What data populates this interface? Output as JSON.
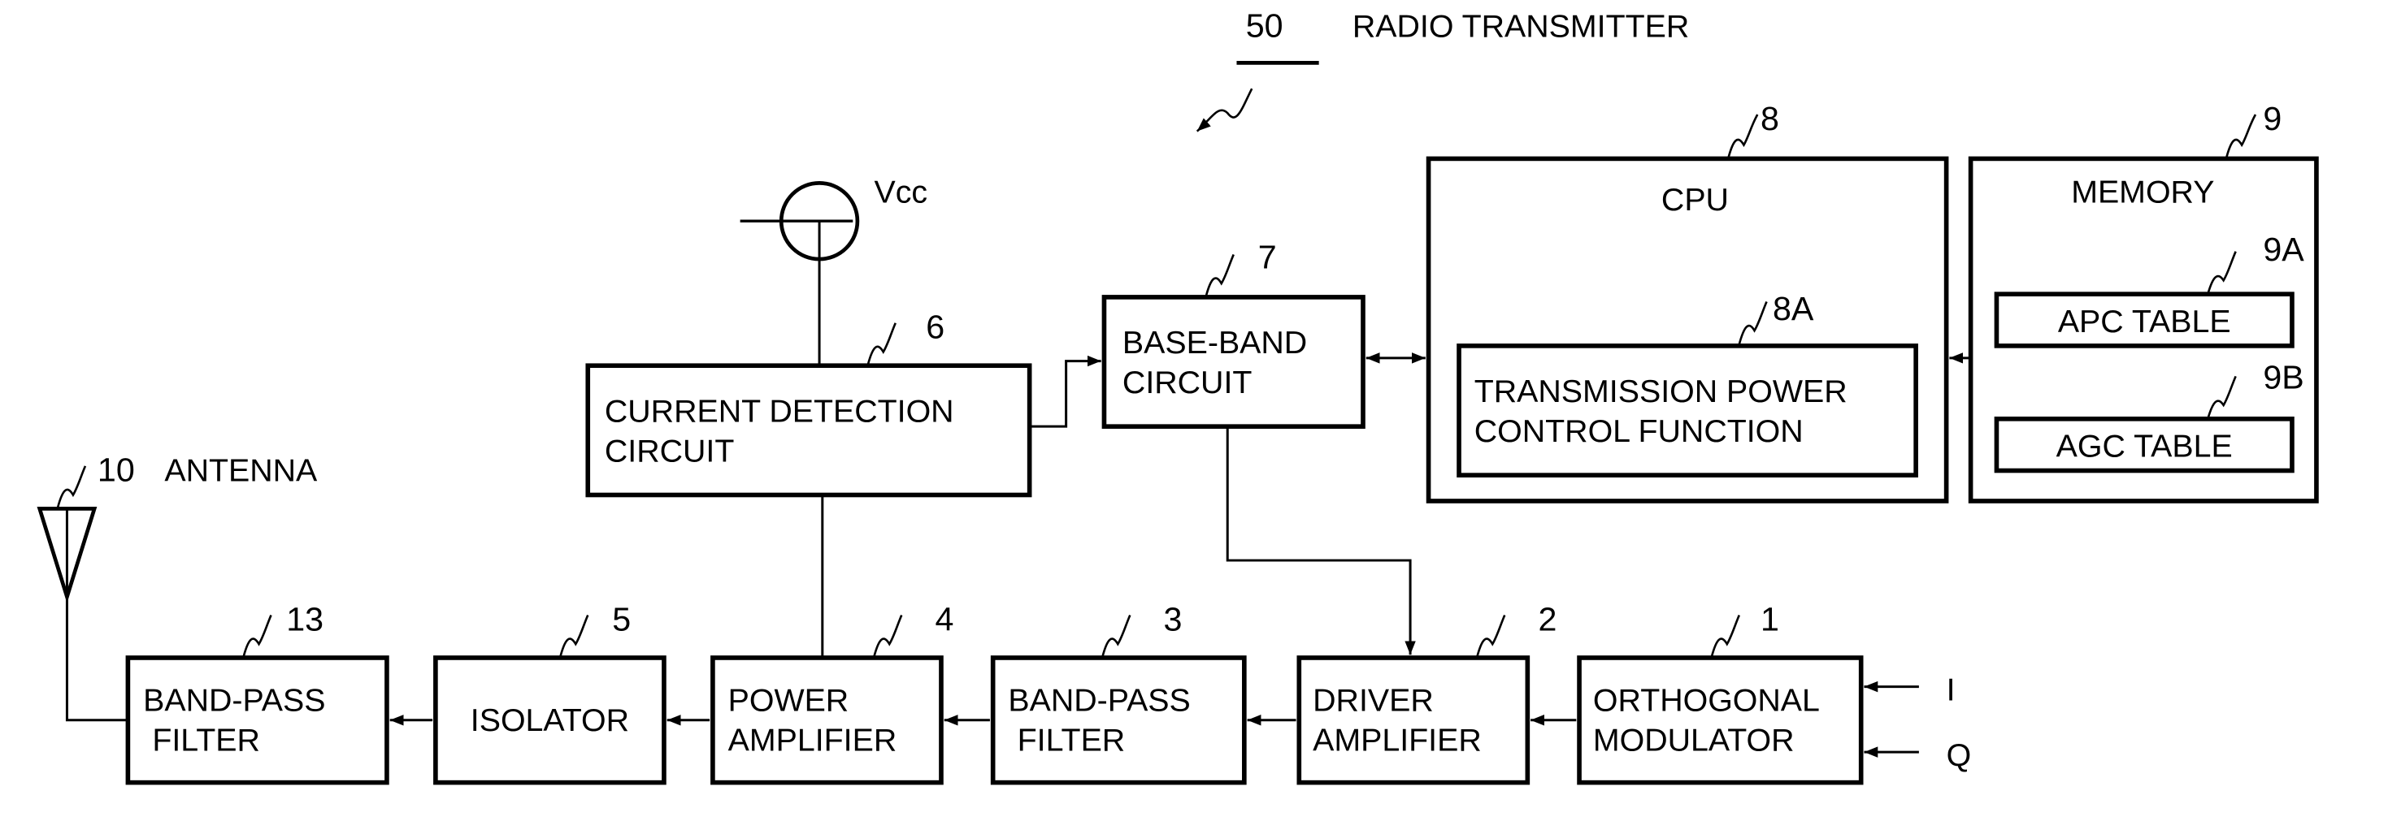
{
  "title": {
    "ref": "50",
    "label": "RADIO TRANSMITTER"
  },
  "supply": {
    "label": "Vcc"
  },
  "antenna": {
    "ref": "10",
    "label": "ANTENNA"
  },
  "blocks": {
    "orthogonal_modulator": {
      "ref": "1",
      "lines": [
        "ORTHOGONAL",
        "MODULATOR"
      ]
    },
    "driver_amplifier": {
      "ref": "2",
      "lines": [
        "DRIVER",
        "AMPLIFIER"
      ]
    },
    "band_pass_filter_3": {
      "ref": "3",
      "lines": [
        "BAND-PASS",
        "FILTER"
      ]
    },
    "power_amplifier": {
      "ref": "4",
      "lines": [
        "POWER",
        "AMPLIFIER"
      ]
    },
    "isolator": {
      "ref": "5",
      "lines": [
        "ISOLATOR"
      ]
    },
    "current_detection": {
      "ref": "6",
      "lines": [
        "CURRENT DETECTION",
        "CIRCUIT"
      ]
    },
    "baseband": {
      "ref": "7",
      "lines": [
        "BASE-BAND",
        "CIRCUIT"
      ]
    },
    "cpu": {
      "ref": "8",
      "lines": [
        "CPU"
      ]
    },
    "tpc_function": {
      "ref": "8A",
      "lines": [
        "TRANSMISSION POWER",
        "CONTROL FUNCTION"
      ]
    },
    "memory": {
      "ref": "9",
      "lines": [
        "MEMORY"
      ]
    },
    "apc_table": {
      "ref": "9A",
      "lines": [
        "APC TABLE"
      ]
    },
    "agc_table": {
      "ref": "9B",
      "lines": [
        "AGC TABLE"
      ]
    },
    "band_pass_filter_13": {
      "ref": "13",
      "lines": [
        "BAND-PASS",
        "FILTER"
      ]
    }
  },
  "inputs": {
    "i": "I",
    "q": "Q"
  }
}
